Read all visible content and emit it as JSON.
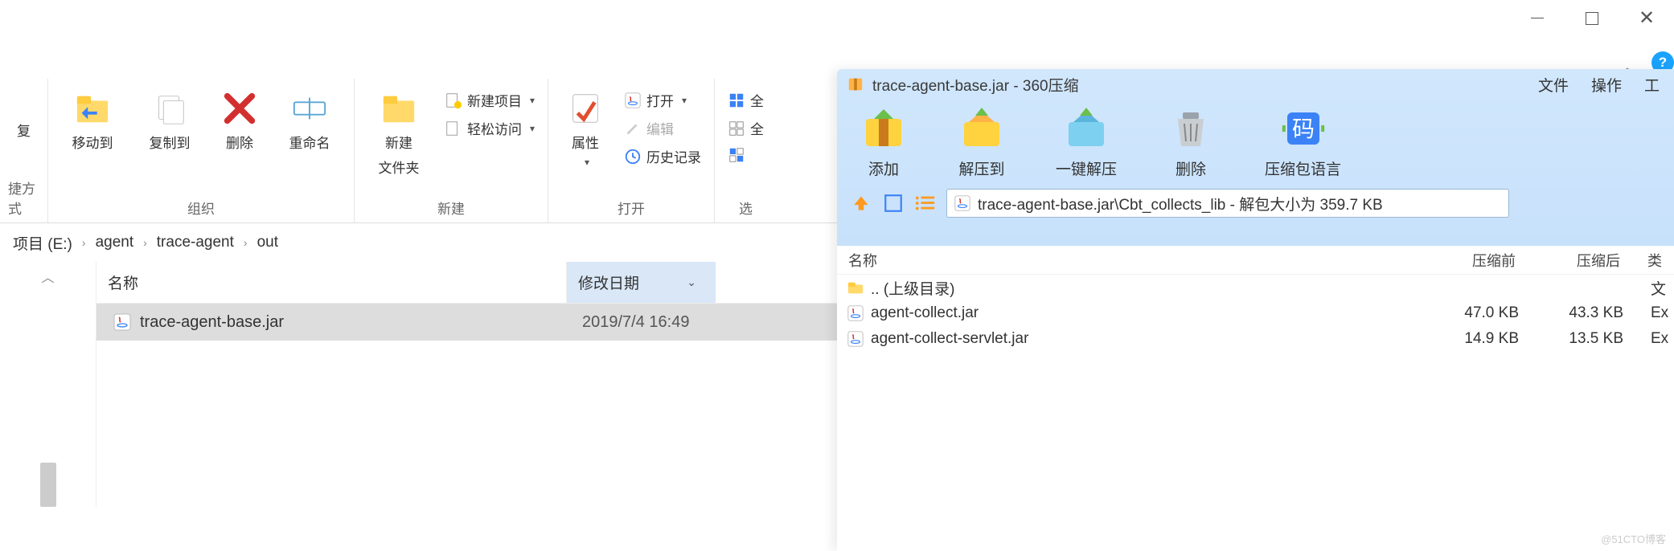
{
  "window_controls": {
    "close_glyph": "✕"
  },
  "ribbon_collapse_glyph": "︿",
  "help_glyph": "?",
  "explorer": {
    "stub_left": {
      "line1": "复",
      "line2": "捷方式"
    },
    "groups": {
      "organize": {
        "label": "组织",
        "move_to": "移动到",
        "copy_to": "复制到",
        "delete": "删除",
        "rename": "重命名"
      },
      "new": {
        "label": "新建",
        "new_folder_line1": "新建",
        "new_folder_line2": "文件夹",
        "new_item": "新建项目",
        "easy_access": "轻松访问"
      },
      "open": {
        "label": "打开",
        "properties": "属性",
        "open": "打开",
        "edit": "编辑",
        "history": "历史记录"
      },
      "select": {
        "label": "选",
        "select_all_prefix": "全",
        "select_none_prefix": "全",
        "invert_prefix": ""
      }
    },
    "breadcrumb": [
      "项目 (E:)",
      "agent",
      "trace-agent",
      "out"
    ],
    "columns": {
      "name": "名称",
      "modified": "修改日期"
    },
    "files": [
      {
        "name": "trace-agent-base.jar",
        "modified": "2019/7/4 16:49"
      }
    ]
  },
  "zip": {
    "title": "trace-agent-base.jar - 360压缩",
    "menu": {
      "file": "文件",
      "operate": "操作",
      "tools": "工"
    },
    "toolbar": {
      "add": "添加",
      "extract_to": "解压到",
      "one_click_extract": "一键解压",
      "delete": "删除",
      "package_lang": "压缩包语言"
    },
    "path": "trace-agent-base.jar\\Cbt_collects_lib - 解包大小为 359.7 KB",
    "columns": {
      "name": "名称",
      "before": "压缩前",
      "after": "压缩后",
      "type": "类"
    },
    "files": [
      {
        "name": ".. (上级目录)",
        "before": "",
        "after": "",
        "type": "文",
        "icon": "folder"
      },
      {
        "name": "agent-collect.jar",
        "before": "47.0 KB",
        "after": "43.3 KB",
        "type": "Ex",
        "icon": "jar"
      },
      {
        "name": "agent-collect-servlet.jar",
        "before": "14.9 KB",
        "after": "13.5 KB",
        "type": "Ex",
        "icon": "jar"
      }
    ]
  },
  "watermark": "@51CTO博客"
}
